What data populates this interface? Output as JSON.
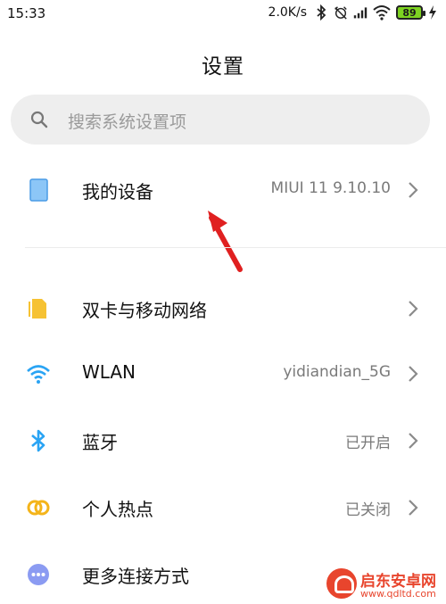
{
  "status_bar": {
    "time": "15:33",
    "network_speed": "2.0K/s",
    "battery_level": "89",
    "icons": [
      "bluetooth-icon",
      "alarm-off-icon",
      "signal-icon",
      "wifi-icon",
      "battery-icon",
      "charging-icon"
    ]
  },
  "page": {
    "title": "设置"
  },
  "search": {
    "placeholder": "搜索系统设置项"
  },
  "items": [
    {
      "label": "我的设备",
      "value": "MIUI 11 9.10.10",
      "icon": "device-icon",
      "color": "#5aa8f0"
    },
    {
      "label": "双卡与移动网络",
      "value": "",
      "icon": "sim-card-icon",
      "color": "#f8c234"
    },
    {
      "label": "WLAN",
      "value": "yidiandian_5G",
      "icon": "wifi-icon",
      "color": "#2aa4f4"
    },
    {
      "label": "蓝牙",
      "value": "已开启",
      "icon": "bluetooth-icon",
      "color": "#2aa4f4"
    },
    {
      "label": "个人热点",
      "value": "已关闭",
      "icon": "hotspot-icon",
      "color": "#f4b41a"
    },
    {
      "label": "更多连接方式",
      "value": "",
      "icon": "more-connections-icon",
      "color": "#7d8cf0"
    }
  ],
  "watermark": {
    "line1": "启东安卓网",
    "line2": "www.qdltd.com"
  },
  "colors": {
    "accent_red": "#e02020",
    "chevron": "#9a9a9a"
  }
}
